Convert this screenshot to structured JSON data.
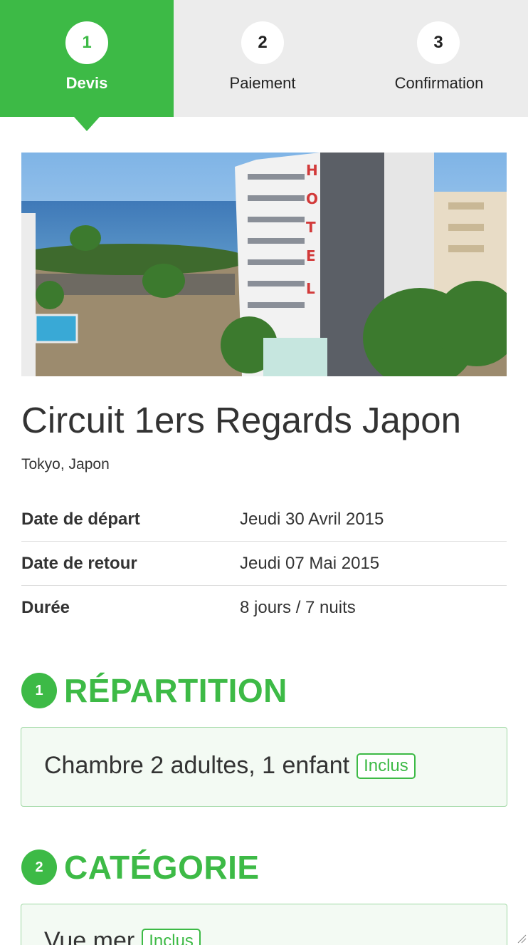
{
  "stepper": {
    "steps": [
      {
        "number": "1",
        "label": "Devis",
        "active": true
      },
      {
        "number": "2",
        "label": "Paiement",
        "active": false
      },
      {
        "number": "3",
        "label": "Confirmation",
        "active": false
      }
    ]
  },
  "hero": {
    "sign_text": "HOTEL"
  },
  "product": {
    "title": "Circuit 1ers Regards Japon",
    "location": "Tokyo, Japon"
  },
  "info": [
    {
      "key": "Date de départ",
      "value": "Jeudi 30 Avril 2015"
    },
    {
      "key": "Date de retour",
      "value": "Jeudi 07 Mai 2015"
    },
    {
      "key": "Durée",
      "value": "8 jours / 7 nuits"
    }
  ],
  "sections": [
    {
      "number": "1",
      "title": "RÉPARTITION",
      "option": "Chambre 2 adultes, 1 enfant",
      "badge": "Inclus"
    },
    {
      "number": "2",
      "title": "CATÉGORIE",
      "option": "Vue mer",
      "badge": "Inclus"
    }
  ],
  "colors": {
    "accent": "#3dba46",
    "stepper_bg": "#ececec",
    "box_bg": "#f3faf3"
  }
}
